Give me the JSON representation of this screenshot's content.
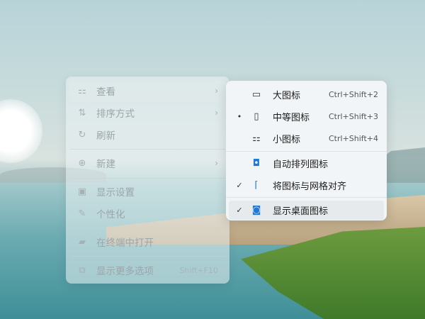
{
  "context_menu": {
    "items": [
      {
        "label": "查看",
        "icon": "grid-icon",
        "submenu": true
      },
      {
        "label": "排序方式",
        "icon": "sort-icon",
        "submenu": true
      },
      {
        "label": "刷新",
        "icon": "refresh-icon"
      },
      {
        "label": "新建",
        "icon": "plus-circle-icon",
        "submenu": true
      },
      {
        "label": "显示设置",
        "icon": "display-settings-icon"
      },
      {
        "label": "个性化",
        "icon": "brush-icon"
      },
      {
        "label": "在终端中打开",
        "icon": "terminal-icon"
      },
      {
        "label": "显示更多选项",
        "icon": "open-external-icon",
        "shortcut": "Shift+F10"
      }
    ]
  },
  "view_submenu": {
    "items": [
      {
        "label": "大图标",
        "icon": "large-icon",
        "shortcut": "Ctrl+Shift+2",
        "mark": ""
      },
      {
        "label": "中等图标",
        "icon": "medium-icon",
        "shortcut": "Ctrl+Shift+3",
        "mark": "•"
      },
      {
        "label": "小图标",
        "icon": "small-icon",
        "shortcut": "Ctrl+Shift+4",
        "mark": ""
      },
      {
        "label": "自动排列图标",
        "icon": "auto-arrange-icon",
        "mark": ""
      },
      {
        "label": "将图标与网格对齐",
        "icon": "align-grid-icon",
        "mark": "✓"
      },
      {
        "label": "显示桌面图标",
        "icon": "show-desktop-icon",
        "mark": "✓"
      }
    ]
  },
  "colors": {
    "accent": "#1e7ad6"
  }
}
